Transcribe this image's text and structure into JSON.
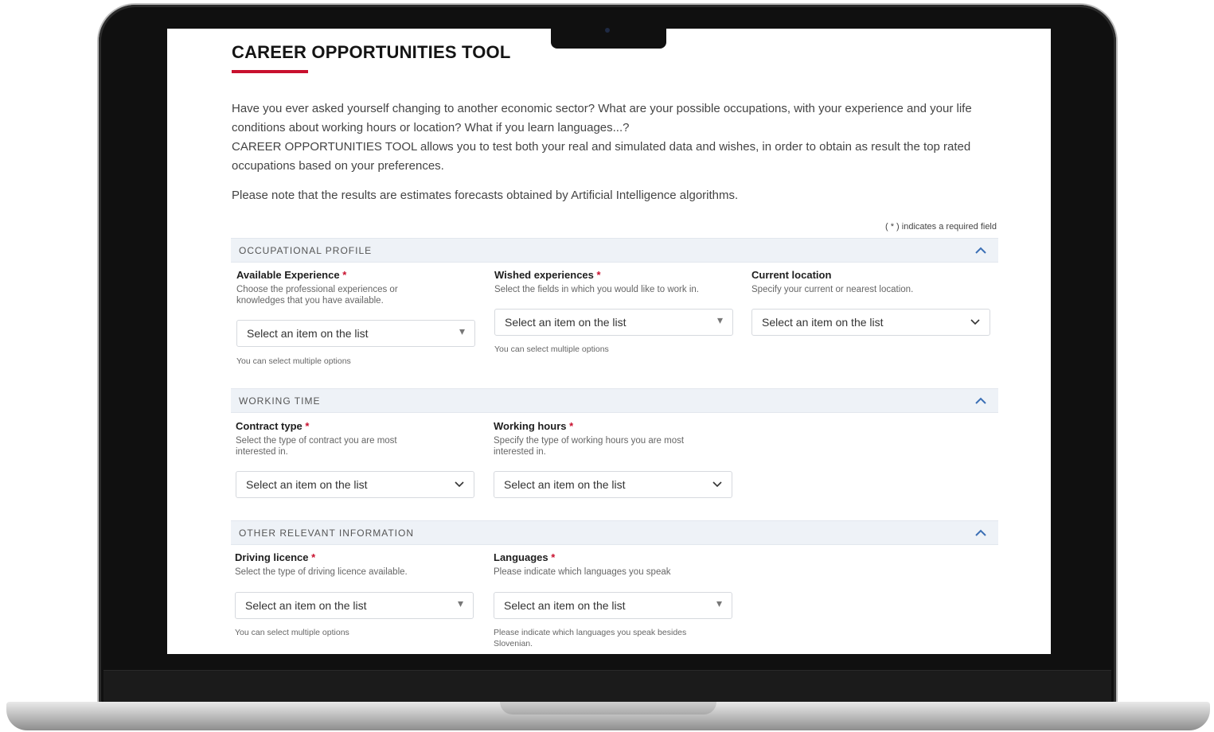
{
  "page": {
    "title": "CAREER OPPORTUNITIES TOOL",
    "intro_1": "Have you ever asked yourself changing to another economic sector? What are your possible occupations, with your experience and your life conditions about working hours or location? What if you learn languages...?",
    "intro_2": "CAREER OPPORTUNITIES TOOL allows you to test both your real and simulated data and wishes, in order to obtain as result the top rated occupations based on your preferences.",
    "note": "Please note that the results are estimates forecasts obtained by Artificial Intelligence algorithms.",
    "required_note": "( * ) indicates a required field"
  },
  "sections": {
    "occupational": {
      "title": "OCCUPATIONAL PROFILE",
      "available_experience": {
        "label": "Available Experience",
        "required_mark": "*",
        "description": "Choose the professional experiences or knowledges that you have available.",
        "placeholder": "Select an item on the list",
        "hint": "You can select multiple options",
        "icon": "caret-small-icon"
      },
      "wished_experiences": {
        "label": "Wished experiences",
        "required_mark": "*",
        "description": "Select the fields in which you would like to work in.",
        "placeholder": "Select an item on the list",
        "hint": "You can select multiple options",
        "icon": "caret-small-icon"
      },
      "current_location": {
        "label": "Current location",
        "description": "Specify your current or nearest location.",
        "placeholder": "Select an item on the list",
        "icon": "chevron-down-icon"
      }
    },
    "working_time": {
      "title": "WORKING TIME",
      "contract_type": {
        "label": "Contract type",
        "required_mark": "*",
        "description": "Select the type of contract you are most interested in.",
        "placeholder": "Select an item on the list",
        "icon": "chevron-down-icon"
      },
      "working_hours": {
        "label": "Working hours",
        "required_mark": "*",
        "description": "Specify the type of working hours you are most interested in.",
        "placeholder": "Select an item on the list",
        "icon": "chevron-down-icon"
      }
    },
    "other": {
      "title": "OTHER RELEVANT INFORMATION",
      "driving_licence": {
        "label": "Driving licence",
        "required_mark": "*",
        "description": "Select the type of driving licence available.",
        "placeholder": "Select an item on the list",
        "hint": "You can select multiple options",
        "icon": "caret-small-icon"
      },
      "languages": {
        "label": "Languages",
        "required_mark": "*",
        "description": "Please indicate which languages you speak",
        "placeholder": "Select an item on the list",
        "hint": "Please indicate which languages you speak besides Slovenian.",
        "icon": "caret-small-icon"
      }
    }
  },
  "colors": {
    "accent": "#c8102e",
    "section_bg": "#eef2f7",
    "collapse_icon": "#3b6fb5"
  }
}
